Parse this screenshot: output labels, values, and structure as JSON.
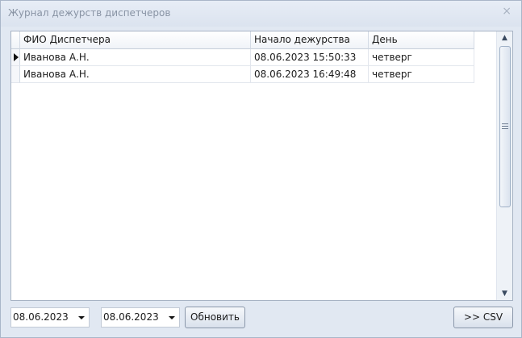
{
  "window": {
    "title": "Журнал дежурств диспетчеров",
    "close_label": "×"
  },
  "grid": {
    "columns": [
      "ФИО Диспетчера",
      "Начало дежурства",
      "День"
    ],
    "rows": [
      {
        "name": "Иванова А.Н.",
        "start": "08.06.2023 15:50:33",
        "day": "четверг",
        "current": true
      },
      {
        "name": "Иванова А.Н.",
        "start": "08.06.2023 16:49:48",
        "day": "четверг",
        "current": false
      }
    ]
  },
  "scrollbar": {
    "up": "▲",
    "down": "▼"
  },
  "footer": {
    "date_from": "08.06.2023",
    "date_to": "08.06.2023",
    "refresh_label": "Обновить",
    "csv_label": ">> CSV"
  }
}
